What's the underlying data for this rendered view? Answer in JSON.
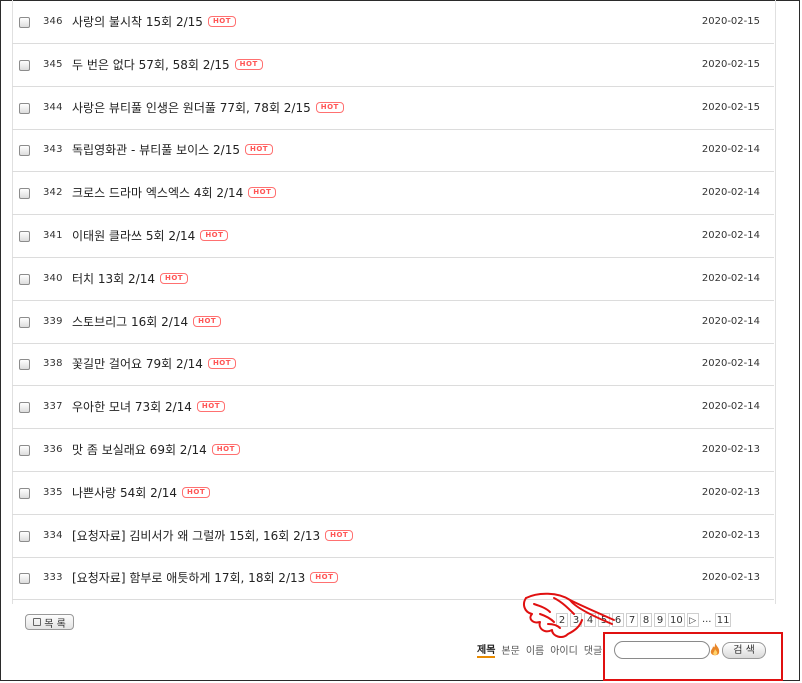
{
  "posts": [
    {
      "num": "346",
      "title": "사랑의 불시착 15회 2/15",
      "hot": "HOT",
      "date": "2020-02-15"
    },
    {
      "num": "345",
      "title": "두 번은 없다 57회, 58회 2/15",
      "hot": "HOT",
      "date": "2020-02-15"
    },
    {
      "num": "344",
      "title": "사랑은 뷰티풀 인생은 원더풀 77회, 78회 2/15",
      "hot": "HOT",
      "date": "2020-02-15"
    },
    {
      "num": "343",
      "title": "독립영화관 - 뷰티풀 보이스 2/15",
      "hot": "HOT",
      "date": "2020-02-14"
    },
    {
      "num": "342",
      "title": "크로스 드라마 엑스엑스 4회 2/14",
      "hot": "HOT",
      "date": "2020-02-14"
    },
    {
      "num": "341",
      "title": "이태원 클라쓰 5회 2/14",
      "hot": "HOT",
      "date": "2020-02-14"
    },
    {
      "num": "340",
      "title": "터치 13회 2/14",
      "hot": "HOT",
      "date": "2020-02-14"
    },
    {
      "num": "339",
      "title": "스토브리그 16회 2/14",
      "hot": "HOT",
      "date": "2020-02-14"
    },
    {
      "num": "338",
      "title": "꽃길만 걸어요 79회 2/14",
      "hot": "HOT",
      "date": "2020-02-14"
    },
    {
      "num": "337",
      "title": "우아한 모녀 73회 2/14",
      "hot": "HOT",
      "date": "2020-02-14"
    },
    {
      "num": "336",
      "title": "맛 좀 보실래요 69회 2/14",
      "hot": "HOT",
      "date": "2020-02-13"
    },
    {
      "num": "335",
      "title": "나쁜사랑 54회 2/14",
      "hot": "HOT",
      "date": "2020-02-13"
    },
    {
      "num": "334",
      "title": "[요청자료] 김비서가 왜 그럴까 15회, 16회 2/13",
      "hot": "HOT",
      "date": "2020-02-13"
    },
    {
      "num": "333",
      "title": "[요청자료] 함부로 애틋하게 17회, 18회 2/13",
      "hot": "HOT",
      "date": "2020-02-13"
    }
  ],
  "list_button": {
    "label": "목 록"
  },
  "pagination": {
    "pages": [
      "2",
      "3",
      "4",
      "5",
      "6",
      "7",
      "8",
      "9",
      "10"
    ],
    "next_icon": "▷",
    "ellipsis": "...",
    "last": "11"
  },
  "search": {
    "options": [
      "제목",
      "본문",
      "이름",
      "아이디",
      "댓글"
    ],
    "active_option": "제목",
    "input_value": "",
    "button_label": "검 색",
    "icon": "flame-icon"
  },
  "colors": {
    "hot": "#ff5555",
    "annotation": "#e01010",
    "active_option": "#e88a00"
  }
}
